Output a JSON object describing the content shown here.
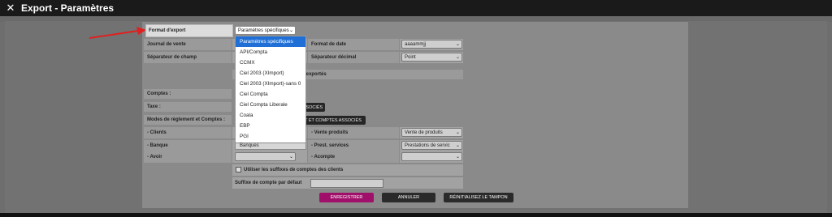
{
  "window": {
    "title": "Export - Paramètres"
  },
  "fields": {
    "format_label": "Format d'export",
    "format_value": "Paramètres spécifiques",
    "journal_label": "Journal de vente",
    "separator_label": "Séparateur de champ",
    "date_format_label": "Format de date",
    "date_format_value": "aaaammjj",
    "decimal_label": "Séparateur décimal",
    "decimal_value": "Point",
    "exported_partial": "jà exportés",
    "comptes_label": "Comptes :",
    "taxe_label": "Taxe :",
    "taxe_button_partial": "SSOCIÉS",
    "modes_label": "Modes de règlement et Comptes :",
    "modes_button_partial": "T ET COMPTES ASSOCIÉS",
    "clients_label": "- Clients",
    "banque_label": "- Banque",
    "avoir_label": "- Avoir",
    "vente_label": "- Vente produits",
    "vente_value": "Vente de produits",
    "prest_label": "- Prest. services",
    "prest_value": "Prestations de servic",
    "acompte_label": "- Acompte",
    "banque_peek": "Banques",
    "suffix_checkbox_label": "Utiliser les suffixes de comptes des clients",
    "default_suffix_label": "Suffixe de compte par défaut"
  },
  "dropdown_options": [
    "Paramètres spécifiques",
    "API/Compta",
    "CCMX",
    "Ciel 2003 (XImport)",
    "Ciel 2003 (XImport)-sans 0",
    "Ciel Compta",
    "Ciel Compta Liberale",
    "Coala",
    "EBP",
    "PGI"
  ],
  "buttons": {
    "save": "ENREGISTRER",
    "cancel": "ANNULER",
    "reset": "RÉINITIALISEZ LE TAMPON"
  },
  "colors": {
    "save_button": "#a0106a",
    "annotation_arrow": "#e02020",
    "selected_option": "#1f6fd6"
  },
  "icons": {
    "close": "close-icon",
    "chevron": "chevron-down-icon"
  }
}
